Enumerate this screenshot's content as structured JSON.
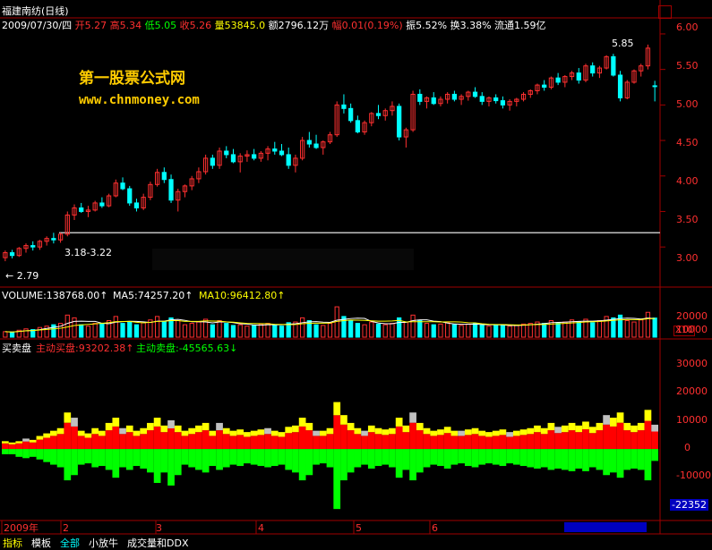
{
  "header": {
    "name": "福建南纺(日线)",
    "date": "2009/07/30/四",
    "open_label": "开",
    "open": "5.27",
    "high_label": "高",
    "high": "5.34",
    "low_label": "低",
    "low": "5.05",
    "close_label": "收",
    "close": "5.26",
    "vol_label": "量",
    "vol": "53845.0",
    "amount": "额2796.12万",
    "amp_label": "幅",
    "amp": "0.01(0.19%)",
    "swing": "振5.52%",
    "turnover": "换3.38%",
    "float": "流通1.59亿"
  },
  "watermark": {
    "line1": "第一股票公式网",
    "line2": "www.chnmoney.com"
  },
  "colors": {
    "up": "#ff3030",
    "down": "#00ffff",
    "buy": "#ff0000",
    "buy_top": "#ffff00",
    "sell": "#00ff00",
    "grey": "#c0c0c0",
    "magenta": "#ff00ff",
    "axis": "#a00000",
    "ma5": "#ffffff",
    "ma10": "#ffff00"
  },
  "price_annotations": {
    "max": "5.85",
    "min": "← 2.79",
    "range": "3.18-3.22"
  },
  "volume_header": {
    "title": "VOLUME:138768.00↑",
    "ma5": "MA5:74257.20↑",
    "ma10": "MA10:96412.80↑"
  },
  "flow_header": {
    "title": "买卖盘",
    "buy": "主动买盘:93202.38↑",
    "sell": "主动卖盘:-45565.63↓"
  },
  "x_axis_labels": [
    "2009年",
    "2",
    "3",
    "4",
    "5",
    "6"
  ],
  "price_axis_ticks": [
    "6.00",
    "5.50",
    "5.00",
    "4.50",
    "4.00",
    "3.50",
    "3.00"
  ],
  "volume_axis_ticks": [
    "20000",
    "10000"
  ],
  "volume_unit": "X10",
  "flow_axis_ticks": [
    "30000",
    "20000",
    "10000",
    "0",
    "-10000"
  ],
  "flow_value_tag": "-22352",
  "bottom_tabs": [
    "指标",
    "模板",
    "全部",
    "小放牛",
    "成交量和DDX"
  ],
  "chart_data": {
    "type": "candlestick",
    "price_ylim": [
      2.7,
      6.1
    ],
    "volume_ylim": [
      0,
      24000
    ],
    "flow_ylim": [
      -25000,
      35000
    ],
    "candles": [
      [
        2.85,
        2.95,
        2.8,
        2.92
      ],
      [
        2.92,
        2.96,
        2.84,
        2.88
      ],
      [
        2.88,
        3.0,
        2.86,
        2.98
      ],
      [
        2.98,
        3.05,
        2.92,
        3.02
      ],
      [
        3.02,
        3.08,
        2.95,
        3.0
      ],
      [
        3.0,
        3.1,
        2.96,
        3.08
      ],
      [
        3.08,
        3.15,
        3.02,
        3.12
      ],
      [
        3.12,
        3.2,
        3.05,
        3.1
      ],
      [
        3.1,
        3.2,
        3.06,
        3.18
      ],
      [
        3.18,
        3.5,
        3.15,
        3.45
      ],
      [
        3.45,
        3.6,
        3.38,
        3.55
      ],
      [
        3.55,
        3.62,
        3.48,
        3.5
      ],
      [
        3.5,
        3.58,
        3.42,
        3.52
      ],
      [
        3.52,
        3.65,
        3.5,
        3.62
      ],
      [
        3.62,
        3.7,
        3.55,
        3.58
      ],
      [
        3.58,
        3.75,
        3.56,
        3.72
      ],
      [
        3.72,
        3.95,
        3.7,
        3.9
      ],
      [
        3.9,
        3.98,
        3.8,
        3.82
      ],
      [
        3.82,
        3.86,
        3.58,
        3.62
      ],
      [
        3.62,
        3.68,
        3.5,
        3.55
      ],
      [
        3.55,
        3.75,
        3.52,
        3.7
      ],
      [
        3.7,
        3.92,
        3.66,
        3.88
      ],
      [
        3.88,
        4.1,
        3.85,
        4.05
      ],
      [
        4.05,
        4.12,
        3.9,
        3.95
      ],
      [
        3.95,
        4.02,
        3.62,
        3.66
      ],
      [
        3.66,
        3.82,
        3.5,
        3.78
      ],
      [
        3.78,
        3.88,
        3.7,
        3.86
      ],
      [
        3.86,
        4.0,
        3.8,
        3.96
      ],
      [
        3.96,
        4.12,
        3.9,
        4.06
      ],
      [
        4.06,
        4.3,
        4.02,
        4.25
      ],
      [
        4.25,
        4.3,
        4.1,
        4.15
      ],
      [
        4.15,
        4.4,
        4.1,
        4.35
      ],
      [
        4.35,
        4.42,
        4.25,
        4.3
      ],
      [
        4.3,
        4.38,
        4.18,
        4.2
      ],
      [
        4.2,
        4.32,
        4.05,
        4.28
      ],
      [
        4.28,
        4.36,
        4.2,
        4.3
      ],
      [
        4.3,
        4.38,
        4.22,
        4.25
      ],
      [
        4.25,
        4.35,
        4.2,
        4.32
      ],
      [
        4.32,
        4.42,
        4.22,
        4.38
      ],
      [
        4.38,
        4.48,
        4.3,
        4.35
      ],
      [
        4.35,
        4.45,
        4.28,
        4.3
      ],
      [
        4.3,
        4.4,
        4.1,
        4.15
      ],
      [
        4.15,
        4.3,
        4.05,
        4.25
      ],
      [
        4.25,
        4.55,
        4.22,
        4.5
      ],
      [
        4.5,
        4.62,
        4.4,
        4.45
      ],
      [
        4.45,
        4.58,
        4.38,
        4.4
      ],
      [
        4.4,
        4.5,
        4.3,
        4.48
      ],
      [
        4.48,
        4.62,
        4.45,
        4.58
      ],
      [
        4.58,
        5.05,
        4.55,
        5.0
      ],
      [
        5.0,
        5.15,
        4.88,
        4.95
      ],
      [
        4.95,
        5.02,
        4.75,
        4.78
      ],
      [
        4.78,
        4.85,
        4.6,
        4.62
      ],
      [
        4.62,
        4.78,
        4.58,
        4.75
      ],
      [
        4.75,
        4.9,
        4.7,
        4.88
      ],
      [
        4.88,
        5.0,
        4.8,
        4.85
      ],
      [
        4.85,
        4.95,
        4.78,
        4.92
      ],
      [
        4.92,
        5.05,
        4.85,
        4.98
      ],
      [
        4.98,
        5.02,
        4.5,
        4.55
      ],
      [
        4.55,
        4.68,
        4.4,
        4.65
      ],
      [
        4.65,
        5.2,
        4.62,
        5.15
      ],
      [
        5.15,
        5.22,
        5.0,
        5.05
      ],
      [
        5.05,
        5.12,
        4.95,
        5.1
      ],
      [
        5.1,
        5.18,
        5.0,
        5.02
      ],
      [
        5.02,
        5.12,
        4.98,
        5.08
      ],
      [
        5.08,
        5.18,
        5.02,
        5.15
      ],
      [
        5.15,
        5.2,
        5.05,
        5.08
      ],
      [
        5.08,
        5.15,
        5.0,
        5.12
      ],
      [
        5.12,
        5.2,
        5.06,
        5.18
      ],
      [
        5.18,
        5.25,
        5.1,
        5.12
      ],
      [
        5.12,
        5.18,
        5.0,
        5.05
      ],
      [
        5.05,
        5.12,
        4.98,
        5.1
      ],
      [
        5.1,
        5.15,
        5.02,
        5.06
      ],
      [
        5.06,
        5.12,
        4.95,
        5.0
      ],
      [
        5.0,
        5.08,
        4.92,
        5.05
      ],
      [
        5.05,
        5.1,
        4.98,
        5.08
      ],
      [
        5.08,
        5.18,
        5.05,
        5.15
      ],
      [
        5.15,
        5.22,
        5.1,
        5.2
      ],
      [
        5.2,
        5.3,
        5.15,
        5.28
      ],
      [
        5.28,
        5.35,
        5.2,
        5.25
      ],
      [
        5.25,
        5.4,
        5.22,
        5.38
      ],
      [
        5.38,
        5.45,
        5.28,
        5.32
      ],
      [
        5.32,
        5.42,
        5.25,
        5.4
      ],
      [
        5.4,
        5.48,
        5.35,
        5.45
      ],
      [
        5.45,
        5.52,
        5.3,
        5.35
      ],
      [
        5.35,
        5.58,
        5.32,
        5.55
      ],
      [
        5.55,
        5.6,
        5.4,
        5.45
      ],
      [
        5.45,
        5.55,
        5.38,
        5.52
      ],
      [
        5.52,
        5.7,
        5.5,
        5.68
      ],
      [
        5.68,
        5.72,
        5.4,
        5.42
      ],
      [
        5.42,
        5.48,
        5.05,
        5.1
      ],
      [
        5.1,
        5.35,
        5.08,
        5.32
      ],
      [
        5.32,
        5.5,
        5.3,
        5.48
      ],
      [
        5.48,
        5.58,
        5.4,
        5.55
      ],
      [
        5.55,
        5.85,
        5.5,
        5.8
      ],
      [
        5.27,
        5.34,
        5.05,
        5.26
      ]
    ],
    "volume": [
      4000,
      3500,
      5000,
      6000,
      5500,
      7000,
      8000,
      9000,
      10000,
      16000,
      14000,
      9000,
      8000,
      10000,
      9500,
      12000,
      15000,
      10000,
      11000,
      9000,
      10500,
      12500,
      15000,
      11000,
      14000,
      12000,
      9000,
      10000,
      11000,
      13000,
      9000,
      12000,
      10000,
      8500,
      9000,
      8000,
      8500,
      9500,
      10000,
      9000,
      8000,
      10500,
      11000,
      14000,
      12000,
      9000,
      8500,
      10000,
      22000,
      15000,
      12000,
      10000,
      9000,
      11000,
      9500,
      9000,
      10000,
      14000,
      11000,
      16000,
      12000,
      10000,
      9000,
      9500,
      10500,
      9000,
      8500,
      9500,
      10000,
      9000,
      8000,
      8500,
      9000,
      8000,
      8500,
      9500,
      10000,
      11000,
      10000,
      12000,
      10500,
      11000,
      12500,
      11000,
      13000,
      10500,
      12000,
      15000,
      14000,
      16000,
      12000,
      11000,
      12500,
      18000,
      13876
    ],
    "buy": [
      3000,
      2500,
      3000,
      4000,
      3500,
      5000,
      6000,
      7000,
      8000,
      14000,
      12000,
      7000,
      6000,
      8000,
      7000,
      10000,
      12000,
      8000,
      9000,
      7000,
      8000,
      10000,
      12000,
      9000,
      11000,
      9000,
      7000,
      8000,
      9000,
      10000,
      7000,
      10000,
      8000,
      7000,
      7500,
      6500,
      7000,
      7500,
      8000,
      7000,
      6500,
      8500,
      9000,
      12000,
      10000,
      7000,
      7000,
      8000,
      18000,
      13000,
      10000,
      8000,
      7000,
      9000,
      8000,
      7500,
      8000,
      12000,
      9000,
      14000,
      10000,
      8000,
      7000,
      7500,
      8500,
      7000,
      7000,
      7500,
      8000,
      7000,
      6500,
      7000,
      7500,
      6500,
      7000,
      7500,
      8000,
      9000,
      8000,
      10000,
      8500,
      9000,
      10000,
      9000,
      10500,
      8500,
      10000,
      13000,
      12000,
      14000,
      10000,
      9000,
      10000,
      15000,
      9320
    ],
    "sell": [
      -2000,
      -2000,
      -3000,
      -3500,
      -3000,
      -4000,
      -5000,
      -6000,
      -7000,
      -12000,
      -10000,
      -6000,
      -5500,
      -7000,
      -6500,
      -8000,
      -11000,
      -7000,
      -8000,
      -6500,
      -7500,
      -9000,
      -13000,
      -9000,
      -14000,
      -10000,
      -6000,
      -7000,
      -8000,
      -9000,
      -6500,
      -8000,
      -7000,
      -6000,
      -6500,
      -5500,
      -6000,
      -6500,
      -7000,
      -6500,
      -6000,
      -8000,
      -9000,
      -12000,
      -10000,
      -6000,
      -5500,
      -7000,
      -23000,
      -12000,
      -9000,
      -7000,
      -6000,
      -7500,
      -6500,
      -6000,
      -7000,
      -11000,
      -8000,
      -12000,
      -9000,
      -7000,
      -6000,
      -6500,
      -7500,
      -6000,
      -5500,
      -6500,
      -7000,
      -6000,
      -5500,
      -6000,
      -6500,
      -5500,
      -6000,
      -6500,
      -7000,
      -7500,
      -7000,
      -8000,
      -7500,
      -8000,
      -8500,
      -7500,
      -8500,
      -7000,
      -8000,
      -10000,
      -9000,
      -11000,
      -8000,
      -7500,
      -8000,
      -12000,
      -4556
    ]
  }
}
